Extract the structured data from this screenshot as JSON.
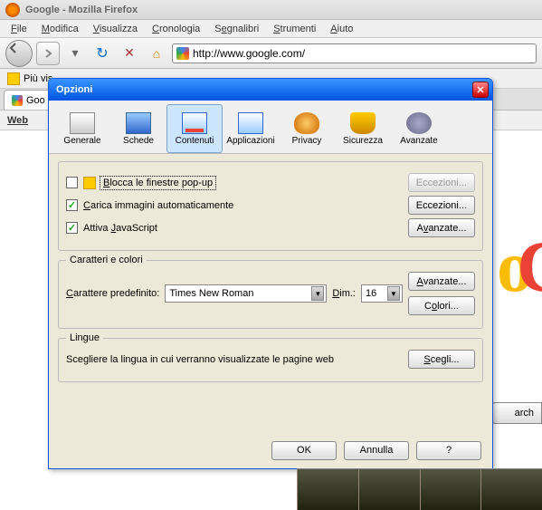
{
  "window": {
    "title": "Google - Mozilla Firefox"
  },
  "menubar": [
    "File",
    "Modifica",
    "Visualizza",
    "Cronologia",
    "Segnalibri",
    "Strumenti",
    "Aiuto"
  ],
  "url": "http://www.google.com/",
  "bookmark_label": "Più vis",
  "tab_label": "Goo",
  "sidebar_label": "Web",
  "search_btn_bg": "arch",
  "dialog": {
    "title": "Opzioni",
    "categories": [
      {
        "label": "Generale"
      },
      {
        "label": "Schede"
      },
      {
        "label": "Contenuti"
      },
      {
        "label": "Applicazioni"
      },
      {
        "label": "Privacy"
      },
      {
        "label": "Sicurezza"
      },
      {
        "label": "Avanzate"
      }
    ],
    "popup": {
      "block_label": "Blocca le finestre pop-up",
      "exceptions_btn": "Eccezioni...",
      "load_images_label": "Carica immagini automaticamente",
      "exceptions2_btn": "Eccezioni...",
      "enable_js_label": "Attiva JavaScript",
      "advanced_btn": "Avanzate..."
    },
    "fonts": {
      "legend": "Caratteri e colori",
      "default_label": "Carattere predefinito:",
      "font_value": "Times New Roman",
      "size_label": "Dim.:",
      "size_value": "16",
      "advanced_btn": "Avanzate...",
      "colors_btn": "Colori..."
    },
    "languages": {
      "legend": "Lingue",
      "desc": "Scegliere la lingua in cui verranno visualizzate le pagine web",
      "choose_btn": "Scegli..."
    },
    "footer": {
      "ok": "OK",
      "cancel": "Annulla",
      "help": "?"
    }
  }
}
